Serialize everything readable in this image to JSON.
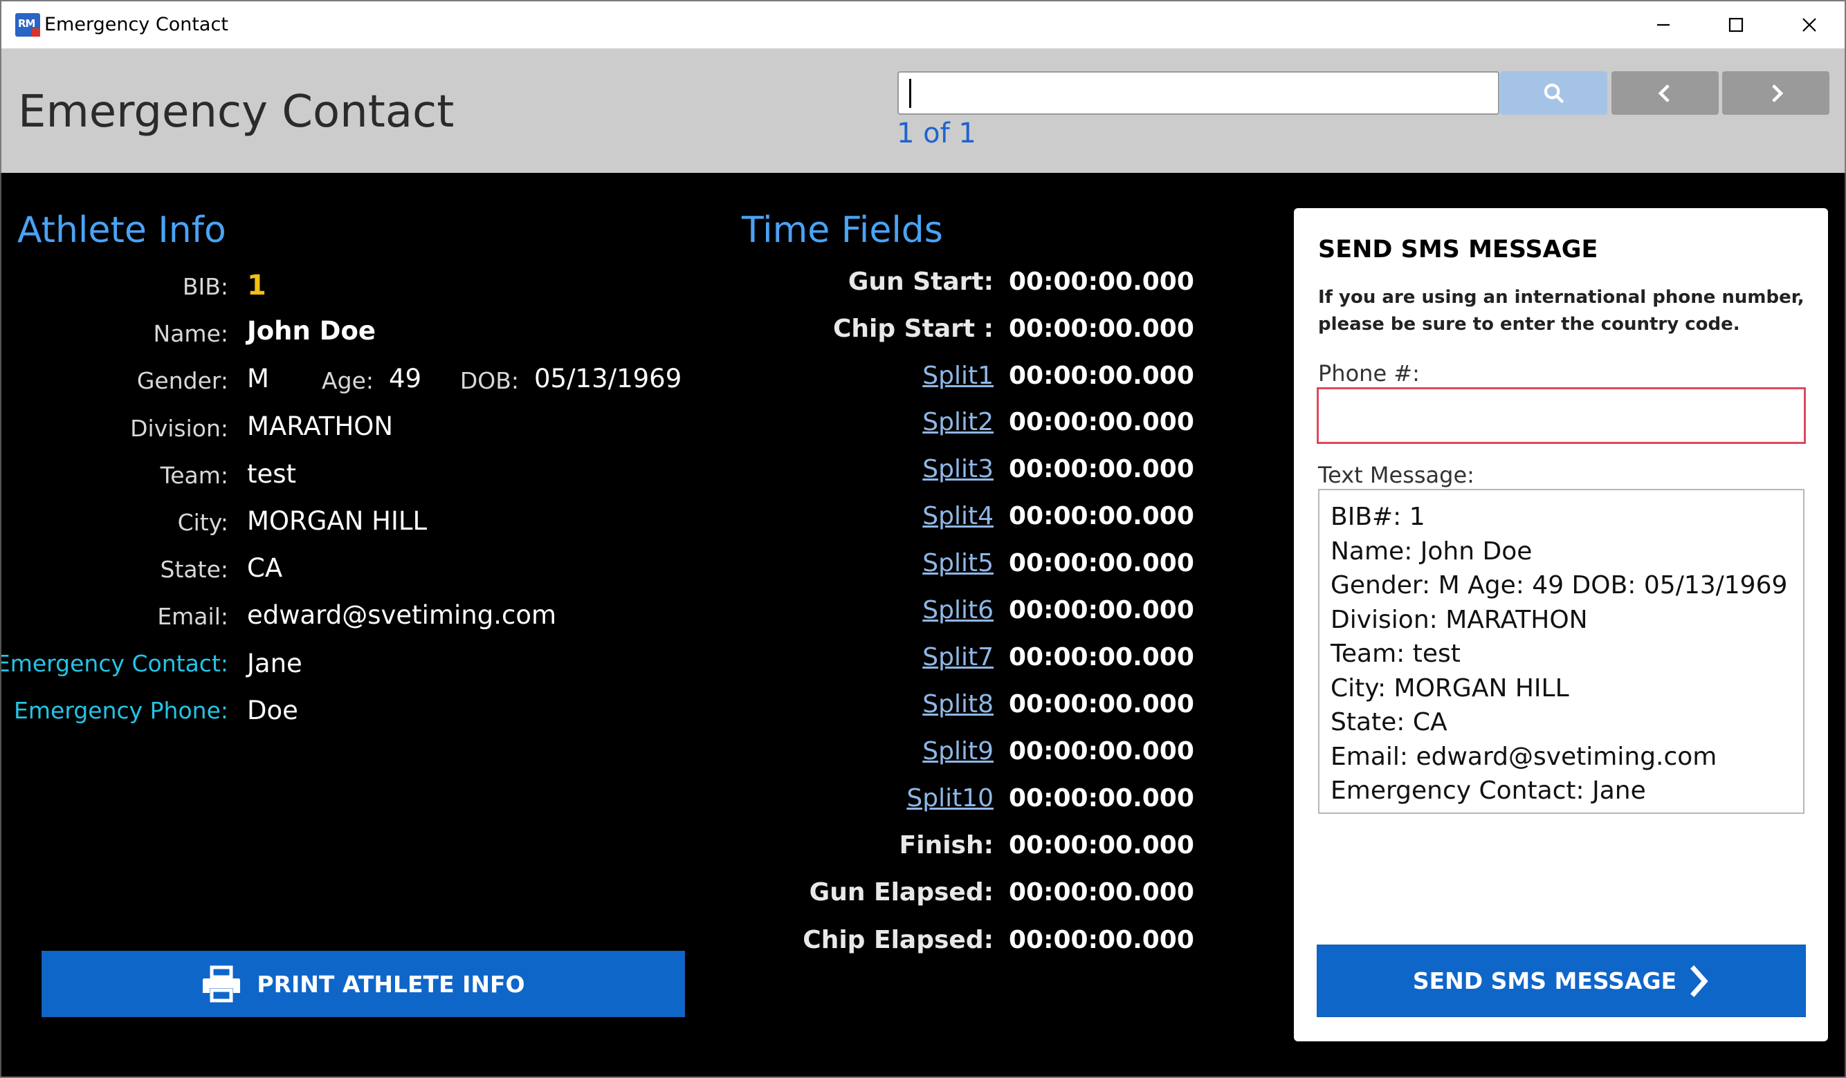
{
  "window": {
    "app_icon_text": "RM",
    "title": "Emergency Contact",
    "minimize_icon": "minimize-icon",
    "maximize_icon": "maximize-icon",
    "close_icon": "close-icon"
  },
  "header": {
    "title": "Emergency Contact",
    "search": {
      "value": "",
      "placeholder": ""
    },
    "result_count": "1 of 1",
    "icons": {
      "search": "search-icon",
      "prev": "chevron-left-icon",
      "next": "chevron-right-icon"
    }
  },
  "athlete": {
    "section_title": "Athlete Info",
    "bib": {
      "label": "BIB:",
      "value": "1"
    },
    "name": {
      "label": "Name:",
      "value": "John Doe"
    },
    "gender": {
      "label": "Gender:",
      "value": "M"
    },
    "age": {
      "label": "Age:",
      "value": "49"
    },
    "dob": {
      "label": "DOB:",
      "value": "05/13/1969"
    },
    "division": {
      "label": "Division:",
      "value": "MARATHON"
    },
    "team": {
      "label": "Team:",
      "value": "test"
    },
    "city": {
      "label": "City:",
      "value": "MORGAN HILL"
    },
    "state": {
      "label": "State:",
      "value": "CA"
    },
    "email": {
      "label": "Email:",
      "value": "edward@svetiming.com"
    },
    "emergency_contact": {
      "label": "Emergency Contact:",
      "value": "Jane"
    },
    "emergency_phone": {
      "label": "Emergency Phone:",
      "value": "Doe"
    },
    "print_button": "PRINT ATHLETE INFO",
    "print_icon": "printer-icon"
  },
  "times": {
    "section_title": "Time Fields",
    "gun_start": {
      "label": "Gun Start:",
      "value": "00:00:00.000"
    },
    "chip_start": {
      "label": "Chip Start :",
      "value": "00:00:00.000"
    },
    "splits": [
      {
        "label": "Split1",
        "value": "00:00:00.000"
      },
      {
        "label": "Split2",
        "value": "00:00:00.000"
      },
      {
        "label": "Split3",
        "value": "00:00:00.000"
      },
      {
        "label": "Split4",
        "value": "00:00:00.000"
      },
      {
        "label": "Split5",
        "value": "00:00:00.000"
      },
      {
        "label": "Split6",
        "value": "00:00:00.000"
      },
      {
        "label": "Split7",
        "value": "00:00:00.000"
      },
      {
        "label": "Split8",
        "value": "00:00:00.000"
      },
      {
        "label": "Split9",
        "value": "00:00:00.000"
      },
      {
        "label": "Split10",
        "value": "00:00:00.000"
      }
    ],
    "finish": {
      "label": "Finish:",
      "value": "00:00:00.000"
    },
    "gun_elapsed": {
      "label": "Gun Elapsed:",
      "value": "00:00:00.000"
    },
    "chip_elapsed": {
      "label": "Chip Elapsed:",
      "value": "00:00:00.000"
    }
  },
  "sms": {
    "title": "SEND SMS MESSAGE",
    "note": "If you are using an international phone number, please be sure to enter the country code.",
    "phone_label": "Phone #:",
    "phone_value": "",
    "message_label": "Text Message:",
    "message_lines": [
      "BIB#: 1",
      "Name: John Doe",
      "Gender: M Age: 49 DOB: 05/13/1969",
      "Division: MARATHON",
      "Team: test",
      "City: MORGAN HILL",
      "State: CA",
      "Email: edward@svetiming.com",
      "Emergency Contact: Jane"
    ],
    "send_button": "SEND SMS MESSAGE",
    "send_icon": "chevron-right-icon"
  },
  "colors": {
    "accent_blue": "#0f66c9",
    "section_title": "#4aa3f5",
    "emergency_label": "#24c4e6",
    "bib": "#f2c012",
    "error_border": "#e0485c"
  }
}
